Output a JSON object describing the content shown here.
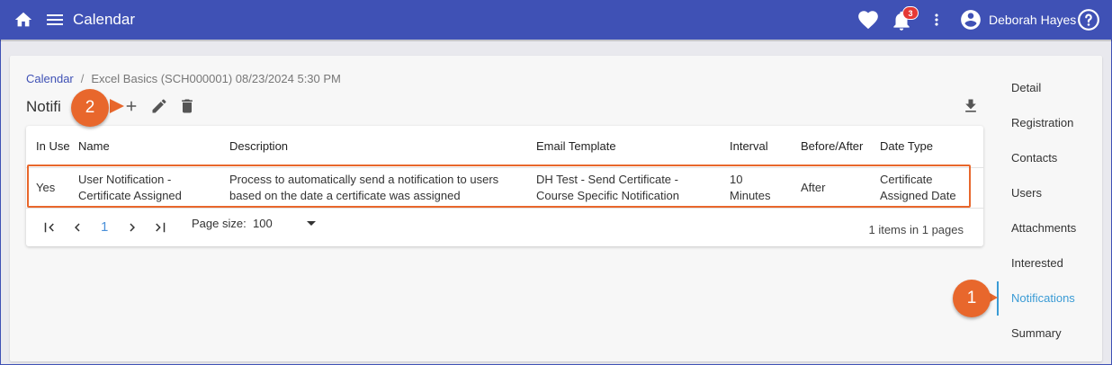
{
  "header": {
    "title": "Calendar",
    "user_name": "Deborah Hayes",
    "notification_count": "3",
    "icons": [
      "home-icon",
      "menu-icon",
      "heart-icon",
      "bell-icon",
      "more-vert-icon",
      "account-icon",
      "help-icon"
    ]
  },
  "breadcrumb": {
    "link": "Calendar",
    "separator": "/",
    "current": "Excel Basics (SCH000001) 08/23/2024 5:30 PM"
  },
  "section": {
    "title": "Notifications",
    "visible_title": "Notifi"
  },
  "table": {
    "columns": [
      "In Use",
      "Name",
      "Description",
      "Email Template",
      "Interval",
      "Before/After",
      "Date Type"
    ],
    "rows": [
      {
        "in_use": "Yes",
        "name": "User Notification - Certificate Assigned",
        "description": "Process to automatically send a notification to users based on the date a certificate was assigned",
        "email_template": "DH Test - Send Certificate - Course Specific Notification",
        "interval": "10 Minutes",
        "before_after": "After",
        "date_type": "Certificate Assigned Date"
      }
    ]
  },
  "pager": {
    "current_page": "1",
    "page_size_label": "Page size:",
    "page_size": "100",
    "items_info": "1 items in 1 pages"
  },
  "sidenav": {
    "items": [
      "Detail",
      "Registration",
      "Contacts",
      "Users",
      "Attachments",
      "Interested",
      "Notifications",
      "Summary"
    ],
    "active": "Notifications"
  },
  "callouts": [
    "1",
    "2"
  ],
  "colors": {
    "header": "#3f51b5",
    "accent": "#3a9bd5",
    "callout": "#e8672c",
    "badge": "#e53935"
  }
}
